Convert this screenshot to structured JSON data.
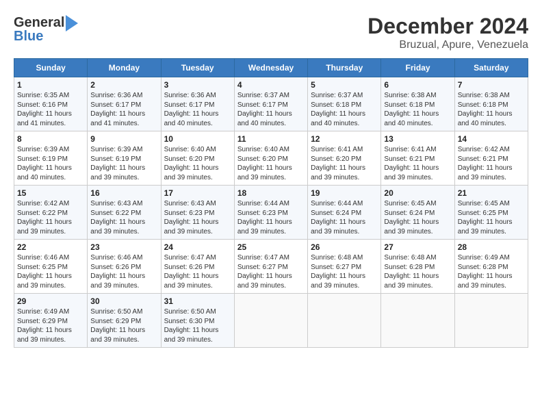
{
  "header": {
    "logo_line1": "General",
    "logo_line2": "Blue",
    "title": "December 2024",
    "subtitle": "Bruzual, Apure, Venezuela"
  },
  "calendar": {
    "days_of_week": [
      "Sunday",
      "Monday",
      "Tuesday",
      "Wednesday",
      "Thursday",
      "Friday",
      "Saturday"
    ],
    "weeks": [
      [
        {
          "day": "1",
          "info": "Sunrise: 6:35 AM\nSunset: 6:16 PM\nDaylight: 11 hours and 41 minutes."
        },
        {
          "day": "2",
          "info": "Sunrise: 6:36 AM\nSunset: 6:17 PM\nDaylight: 11 hours and 41 minutes."
        },
        {
          "day": "3",
          "info": "Sunrise: 6:36 AM\nSunset: 6:17 PM\nDaylight: 11 hours and 40 minutes."
        },
        {
          "day": "4",
          "info": "Sunrise: 6:37 AM\nSunset: 6:17 PM\nDaylight: 11 hours and 40 minutes."
        },
        {
          "day": "5",
          "info": "Sunrise: 6:37 AM\nSunset: 6:18 PM\nDaylight: 11 hours and 40 minutes."
        },
        {
          "day": "6",
          "info": "Sunrise: 6:38 AM\nSunset: 6:18 PM\nDaylight: 11 hours and 40 minutes."
        },
        {
          "day": "7",
          "info": "Sunrise: 6:38 AM\nSunset: 6:18 PM\nDaylight: 11 hours and 40 minutes."
        }
      ],
      [
        {
          "day": "8",
          "info": "Sunrise: 6:39 AM\nSunset: 6:19 PM\nDaylight: 11 hours and 40 minutes."
        },
        {
          "day": "9",
          "info": "Sunrise: 6:39 AM\nSunset: 6:19 PM\nDaylight: 11 hours and 39 minutes."
        },
        {
          "day": "10",
          "info": "Sunrise: 6:40 AM\nSunset: 6:20 PM\nDaylight: 11 hours and 39 minutes."
        },
        {
          "day": "11",
          "info": "Sunrise: 6:40 AM\nSunset: 6:20 PM\nDaylight: 11 hours and 39 minutes."
        },
        {
          "day": "12",
          "info": "Sunrise: 6:41 AM\nSunset: 6:20 PM\nDaylight: 11 hours and 39 minutes."
        },
        {
          "day": "13",
          "info": "Sunrise: 6:41 AM\nSunset: 6:21 PM\nDaylight: 11 hours and 39 minutes."
        },
        {
          "day": "14",
          "info": "Sunrise: 6:42 AM\nSunset: 6:21 PM\nDaylight: 11 hours and 39 minutes."
        }
      ],
      [
        {
          "day": "15",
          "info": "Sunrise: 6:42 AM\nSunset: 6:22 PM\nDaylight: 11 hours and 39 minutes."
        },
        {
          "day": "16",
          "info": "Sunrise: 6:43 AM\nSunset: 6:22 PM\nDaylight: 11 hours and 39 minutes."
        },
        {
          "day": "17",
          "info": "Sunrise: 6:43 AM\nSunset: 6:23 PM\nDaylight: 11 hours and 39 minutes."
        },
        {
          "day": "18",
          "info": "Sunrise: 6:44 AM\nSunset: 6:23 PM\nDaylight: 11 hours and 39 minutes."
        },
        {
          "day": "19",
          "info": "Sunrise: 6:44 AM\nSunset: 6:24 PM\nDaylight: 11 hours and 39 minutes."
        },
        {
          "day": "20",
          "info": "Sunrise: 6:45 AM\nSunset: 6:24 PM\nDaylight: 11 hours and 39 minutes."
        },
        {
          "day": "21",
          "info": "Sunrise: 6:45 AM\nSunset: 6:25 PM\nDaylight: 11 hours and 39 minutes."
        }
      ],
      [
        {
          "day": "22",
          "info": "Sunrise: 6:46 AM\nSunset: 6:25 PM\nDaylight: 11 hours and 39 minutes."
        },
        {
          "day": "23",
          "info": "Sunrise: 6:46 AM\nSunset: 6:26 PM\nDaylight: 11 hours and 39 minutes."
        },
        {
          "day": "24",
          "info": "Sunrise: 6:47 AM\nSunset: 6:26 PM\nDaylight: 11 hours and 39 minutes."
        },
        {
          "day": "25",
          "info": "Sunrise: 6:47 AM\nSunset: 6:27 PM\nDaylight: 11 hours and 39 minutes."
        },
        {
          "day": "26",
          "info": "Sunrise: 6:48 AM\nSunset: 6:27 PM\nDaylight: 11 hours and 39 minutes."
        },
        {
          "day": "27",
          "info": "Sunrise: 6:48 AM\nSunset: 6:28 PM\nDaylight: 11 hours and 39 minutes."
        },
        {
          "day": "28",
          "info": "Sunrise: 6:49 AM\nSunset: 6:28 PM\nDaylight: 11 hours and 39 minutes."
        }
      ],
      [
        {
          "day": "29",
          "info": "Sunrise: 6:49 AM\nSunset: 6:29 PM\nDaylight: 11 hours and 39 minutes."
        },
        {
          "day": "30",
          "info": "Sunrise: 6:50 AM\nSunset: 6:29 PM\nDaylight: 11 hours and 39 minutes."
        },
        {
          "day": "31",
          "info": "Sunrise: 6:50 AM\nSunset: 6:30 PM\nDaylight: 11 hours and 39 minutes."
        },
        null,
        null,
        null,
        null
      ]
    ]
  }
}
